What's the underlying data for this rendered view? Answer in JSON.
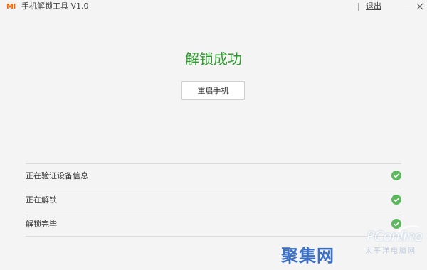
{
  "titlebar": {
    "logo_text": "MI",
    "title": "手机解锁工具 V1.0",
    "logout_label": "退出",
    "minimize_icon": "minimize-icon",
    "close_icon": "close-icon"
  },
  "main": {
    "result_title": "解锁成功",
    "reboot_button_label": "重启手机"
  },
  "steps": [
    {
      "label": "正在验证设备信息",
      "status": "done",
      "icon": "check-circle-icon"
    },
    {
      "label": "正在解锁",
      "status": "done",
      "icon": "check-circle-icon"
    },
    {
      "label": "解锁完毕",
      "status": "done",
      "icon": "check-circle-icon"
    }
  ],
  "watermark": {
    "brand": "PConline",
    "subtitle": "太平洋电脑网",
    "logo": "聚集网"
  },
  "colors": {
    "accent_orange": "#ff6700",
    "success_green": "#2e9b2e",
    "check_green": "#5cb85c",
    "background": "#f4f4f4"
  }
}
